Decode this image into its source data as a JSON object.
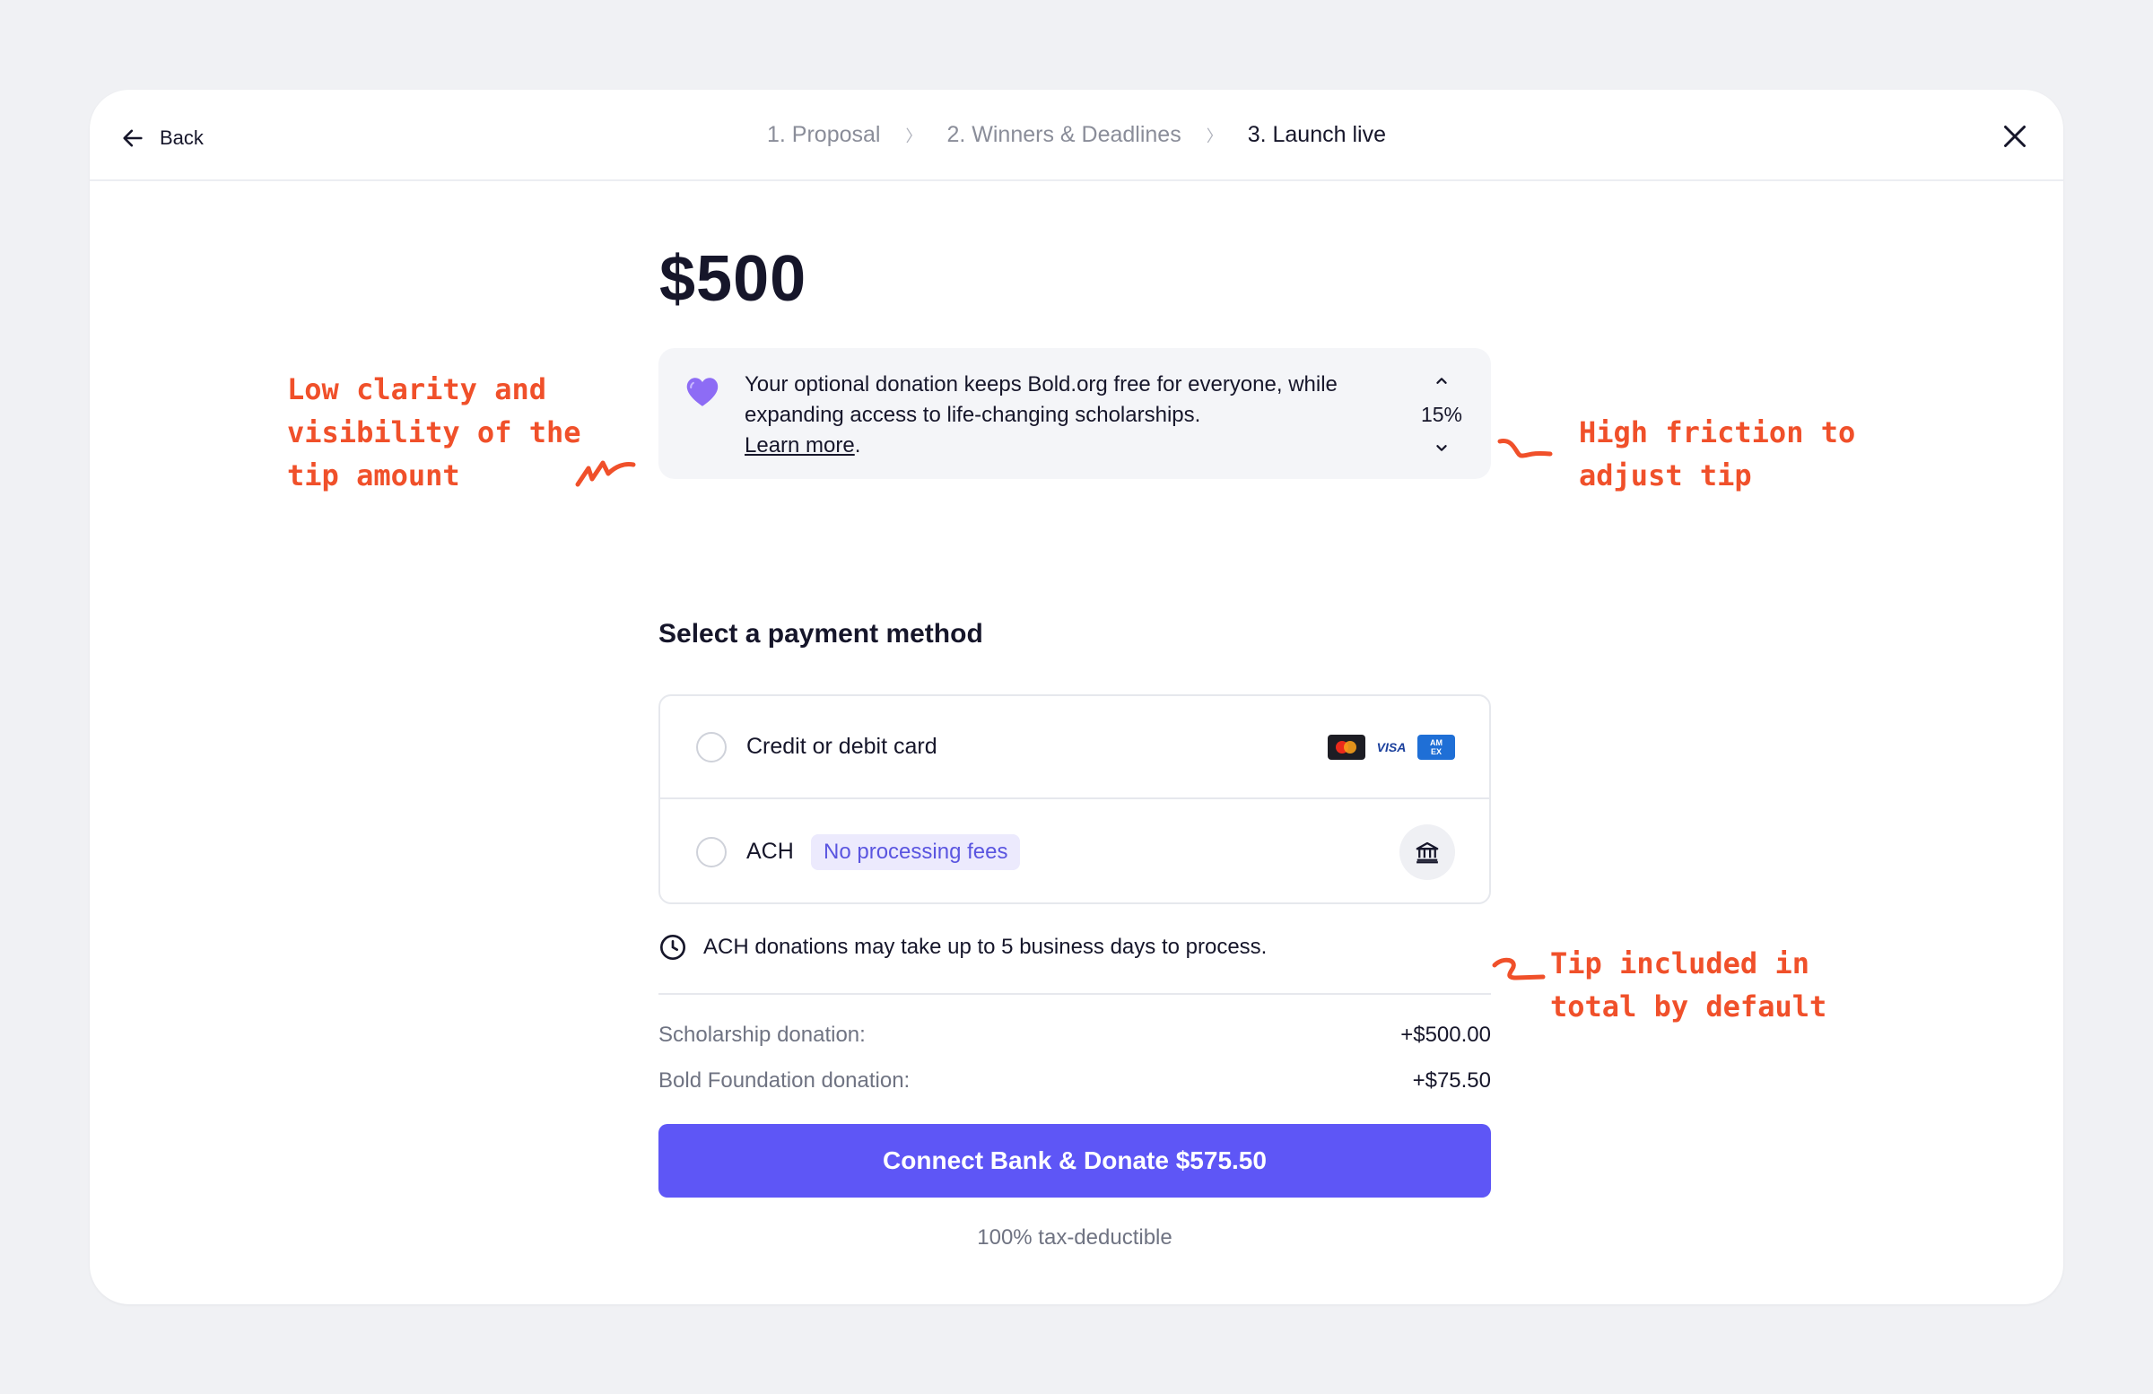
{
  "header": {
    "back_label": "Back",
    "steps": [
      {
        "label": "1. Proposal",
        "state": "done"
      },
      {
        "label": "2. Winners & Deadlines",
        "state": "done"
      },
      {
        "label": "3. Launch live",
        "state": "active"
      }
    ],
    "step_separator": "〉"
  },
  "amount": "$500",
  "tip_box": {
    "text": "Your optional donation keeps Bold.org free for everyone, while expanding access to life-changing scholarships.",
    "learn_more": "Learn more",
    "period": ".",
    "percent": "15%",
    "icon": "purple-heart-icon"
  },
  "payment": {
    "title": "Select a payment method",
    "methods": [
      {
        "label": "Credit or debit card",
        "icons": [
          "mastercard-icon",
          "visa-icon",
          "amex-icon"
        ],
        "selected": false
      },
      {
        "label": "ACH",
        "badge": "No processing fees",
        "icon": "bank-icon",
        "selected": false
      }
    ],
    "visa_text": "VISA",
    "amex_text": "AM EX"
  },
  "notice": "ACH donations may take up to 5 business days to process.",
  "summary": [
    {
      "label": "Scholarship donation:",
      "value": "+$500.00"
    },
    {
      "label": "Bold Foundation donation:",
      "value": "+$75.50"
    }
  ],
  "cta_label": "Connect Bank & Donate $575.50",
  "footer_note": "100% tax-deductible",
  "annotations": [
    "Low clarity and\nvisibility of the\ntip amount",
    "High friction to\nadjust tip",
    "Tip included in\ntotal by default"
  ],
  "colors": {
    "accent": "#5e56f6",
    "annotation": "#f0502a",
    "badge_bg": "#eceafd"
  }
}
